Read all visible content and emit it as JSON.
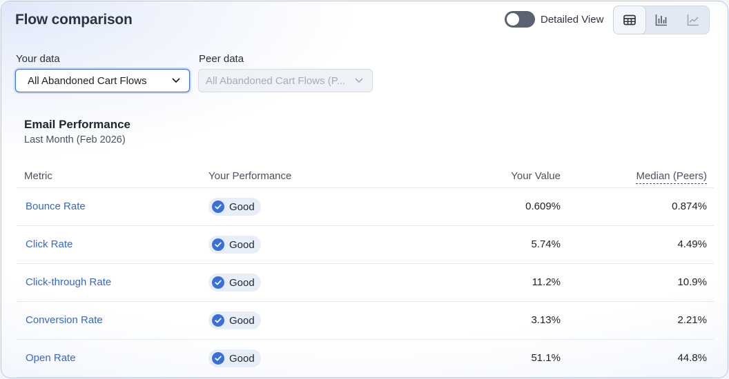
{
  "header": {
    "title": "Flow comparison",
    "toggle_label": "Detailed View",
    "views": [
      "table-view",
      "bar-chart-view",
      "line-chart-view"
    ]
  },
  "filters": {
    "your_data_label": "Your data",
    "your_data_value": "All Abandoned Cart Flows",
    "peer_data_label": "Peer data",
    "peer_data_value": "All Abandoned Cart Flows (P..."
  },
  "section": {
    "title": "Email Performance",
    "subtitle": "Last Month (Feb 2026)"
  },
  "table": {
    "columns": {
      "metric": "Metric",
      "performance": "Your Performance",
      "value": "Your Value",
      "median": "Median (Peers)"
    },
    "rows": [
      {
        "metric": "Bounce Rate",
        "performance": "Good",
        "value": "0.609%",
        "median": "0.874%"
      },
      {
        "metric": "Click Rate",
        "performance": "Good",
        "value": "5.74%",
        "median": "4.49%"
      },
      {
        "metric": "Click-through Rate",
        "performance": "Good",
        "value": "11.2%",
        "median": "10.9%"
      },
      {
        "metric": "Conversion Rate",
        "performance": "Good",
        "value": "3.13%",
        "median": "2.21%"
      },
      {
        "metric": "Open Rate",
        "performance": "Good",
        "value": "51.1%",
        "median": "44.8%"
      }
    ]
  },
  "colors": {
    "accent": "#3b6fd8",
    "link": "#3568c5",
    "badge_bg": "#e8eef8"
  }
}
